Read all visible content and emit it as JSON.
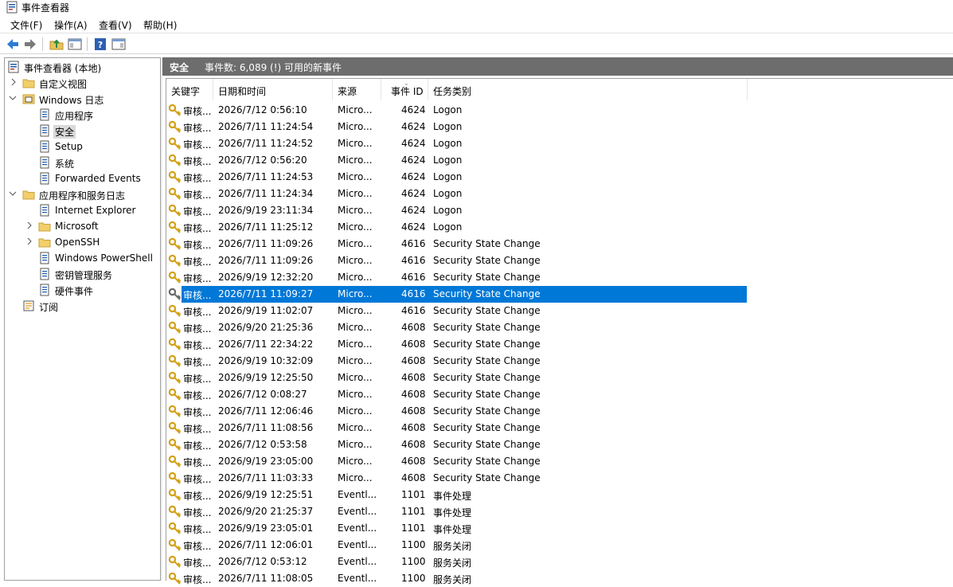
{
  "window": {
    "title": "事件查看器"
  },
  "menu": [
    "文件(F)",
    "操作(A)",
    "查看(V)",
    "帮助(H)"
  ],
  "toolbar": {
    "icons": [
      "back-icon",
      "forward-icon",
      "up-folder-icon",
      "show-hide-tree-icon",
      "help-icon",
      "show-hide-action-pane-icon"
    ]
  },
  "tree": [
    {
      "label": "事件查看器 (本地)",
      "level": 0,
      "chevron": "",
      "icon": "event-viewer-icon"
    },
    {
      "label": "自定义视图",
      "level": 1,
      "chevron": "right",
      "icon": "folder-icon"
    },
    {
      "label": "Windows 日志",
      "level": 1,
      "chevron": "down",
      "icon": "windows-logs-icon"
    },
    {
      "label": "应用程序",
      "level": 2,
      "chevron": "",
      "icon": "log-icon"
    },
    {
      "label": "安全",
      "level": 2,
      "chevron": "",
      "icon": "log-icon",
      "selected": true
    },
    {
      "label": "Setup",
      "level": 2,
      "chevron": "",
      "icon": "log-icon"
    },
    {
      "label": "系统",
      "level": 2,
      "chevron": "",
      "icon": "log-icon"
    },
    {
      "label": "Forwarded Events",
      "level": 2,
      "chevron": "",
      "icon": "log-icon"
    },
    {
      "label": "应用程序和服务日志",
      "level": 1,
      "chevron": "down",
      "icon": "folder-icon"
    },
    {
      "label": "Internet Explorer",
      "level": 2,
      "chevron": "",
      "icon": "log-icon"
    },
    {
      "label": "Microsoft",
      "level": 2,
      "chevron": "right",
      "icon": "folder-icon"
    },
    {
      "label": "OpenSSH",
      "level": 2,
      "chevron": "right",
      "icon": "folder-icon"
    },
    {
      "label": "Windows PowerShell",
      "level": 2,
      "chevron": "",
      "icon": "log-icon"
    },
    {
      "label": "密钥管理服务",
      "level": 2,
      "chevron": "",
      "icon": "log-icon"
    },
    {
      "label": "硬件事件",
      "level": 2,
      "chevron": "",
      "icon": "log-icon"
    },
    {
      "label": "订阅",
      "level": 0,
      "chevron": "",
      "icon": "subscriptions-icon"
    }
  ],
  "panel": {
    "name": "安全",
    "info": "事件数: 6,089 (!) 可用的新事件"
  },
  "columns": [
    "关键字",
    "日期和时间",
    "来源",
    "事件 ID",
    "任务类别"
  ],
  "rows": [
    {
      "keyword": "审核...",
      "datetime": "2026/7/12 0:56:10",
      "source": "Micro...",
      "id": "4624",
      "category": "Logon"
    },
    {
      "keyword": "审核...",
      "datetime": "2026/7/11 11:24:54",
      "source": "Micro...",
      "id": "4624",
      "category": "Logon"
    },
    {
      "keyword": "审核...",
      "datetime": "2026/7/11 11:24:52",
      "source": "Micro...",
      "id": "4624",
      "category": "Logon"
    },
    {
      "keyword": "审核...",
      "datetime": "2026/7/12 0:56:20",
      "source": "Micro...",
      "id": "4624",
      "category": "Logon"
    },
    {
      "keyword": "审核...",
      "datetime": "2026/7/11 11:24:53",
      "source": "Micro...",
      "id": "4624",
      "category": "Logon"
    },
    {
      "keyword": "审核...",
      "datetime": "2026/7/11 11:24:34",
      "source": "Micro...",
      "id": "4624",
      "category": "Logon"
    },
    {
      "keyword": "审核...",
      "datetime": "2026/9/19 23:11:34",
      "source": "Micro...",
      "id": "4624",
      "category": "Logon"
    },
    {
      "keyword": "审核...",
      "datetime": "2026/7/11 11:25:12",
      "source": "Micro...",
      "id": "4624",
      "category": "Logon"
    },
    {
      "keyword": "审核...",
      "datetime": "2026/7/11 11:09:26",
      "source": "Micro...",
      "id": "4616",
      "category": "Security State Change"
    },
    {
      "keyword": "审核...",
      "datetime": "2026/7/11 11:09:26",
      "source": "Micro...",
      "id": "4616",
      "category": "Security State Change"
    },
    {
      "keyword": "审核...",
      "datetime": "2026/9/19 12:32:20",
      "source": "Micro...",
      "id": "4616",
      "category": "Security State Change"
    },
    {
      "keyword": "审核...",
      "datetime": "2026/7/11 11:09:27",
      "source": "Micro...",
      "id": "4616",
      "category": "Security State Change",
      "selected": true
    },
    {
      "keyword": "审核...",
      "datetime": "2026/9/19 11:02:07",
      "source": "Micro...",
      "id": "4616",
      "category": "Security State Change"
    },
    {
      "keyword": "审核...",
      "datetime": "2026/9/20 21:25:36",
      "source": "Micro...",
      "id": "4608",
      "category": "Security State Change"
    },
    {
      "keyword": "审核...",
      "datetime": "2026/7/11 22:34:22",
      "source": "Micro...",
      "id": "4608",
      "category": "Security State Change"
    },
    {
      "keyword": "审核...",
      "datetime": "2026/9/19 10:32:09",
      "source": "Micro...",
      "id": "4608",
      "category": "Security State Change"
    },
    {
      "keyword": "审核...",
      "datetime": "2026/9/19 12:25:50",
      "source": "Micro...",
      "id": "4608",
      "category": "Security State Change"
    },
    {
      "keyword": "审核...",
      "datetime": "2026/7/12 0:08:27",
      "source": "Micro...",
      "id": "4608",
      "category": "Security State Change"
    },
    {
      "keyword": "审核...",
      "datetime": "2026/7/11 12:06:46",
      "source": "Micro...",
      "id": "4608",
      "category": "Security State Change"
    },
    {
      "keyword": "审核...",
      "datetime": "2026/7/11 11:08:56",
      "source": "Micro...",
      "id": "4608",
      "category": "Security State Change"
    },
    {
      "keyword": "审核...",
      "datetime": "2026/7/12 0:53:58",
      "source": "Micro...",
      "id": "4608",
      "category": "Security State Change"
    },
    {
      "keyword": "审核...",
      "datetime": "2026/9/19 23:05:00",
      "source": "Micro...",
      "id": "4608",
      "category": "Security State Change"
    },
    {
      "keyword": "审核...",
      "datetime": "2026/7/11 11:03:33",
      "source": "Micro...",
      "id": "4608",
      "category": "Security State Change"
    },
    {
      "keyword": "审核...",
      "datetime": "2026/9/19 12:25:51",
      "source": "Eventl...",
      "id": "1101",
      "category": "事件处理"
    },
    {
      "keyword": "审核...",
      "datetime": "2026/9/20 21:25:37",
      "source": "Eventl...",
      "id": "1101",
      "category": "事件处理"
    },
    {
      "keyword": "审核...",
      "datetime": "2026/9/19 23:05:01",
      "source": "Eventl...",
      "id": "1101",
      "category": "事件处理"
    },
    {
      "keyword": "审核...",
      "datetime": "2026/7/11 12:06:01",
      "source": "Eventl...",
      "id": "1100",
      "category": "服务关闭"
    },
    {
      "keyword": "审核...",
      "datetime": "2026/7/12 0:53:12",
      "source": "Eventl...",
      "id": "1100",
      "category": "服务关闭"
    },
    {
      "keyword": "审核...",
      "datetime": "2026/7/11 11:08:05",
      "source": "Eventl...",
      "id": "1100",
      "category": "服务关闭"
    }
  ],
  "colors": {
    "selection": "#0078d7",
    "header_bar": "#6d6d6d",
    "tree_selection": "#d9d9d9",
    "key_icon": "#d4a017"
  }
}
